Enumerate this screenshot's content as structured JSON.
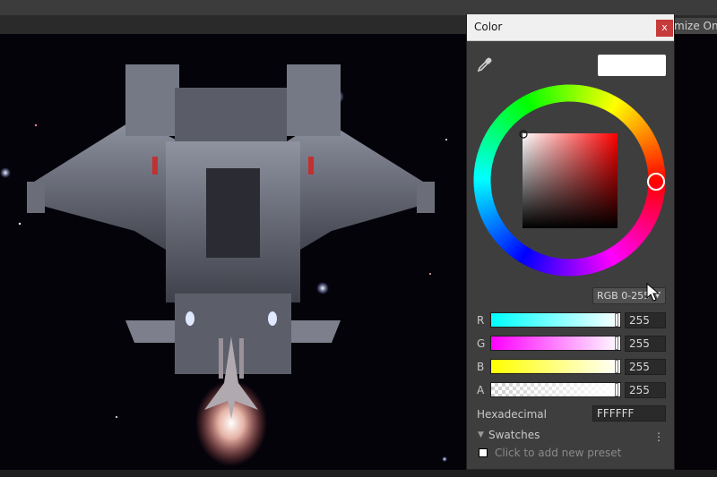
{
  "background": {
    "partial_label": "mize On"
  },
  "color_window": {
    "title": "Color",
    "close_label": "x",
    "preview_color": "#ffffff",
    "mode": "RGB 0-255",
    "channels": [
      {
        "label": "R",
        "value": "255"
      },
      {
        "label": "G",
        "value": "255"
      },
      {
        "label": "B",
        "value": "255"
      },
      {
        "label": "A",
        "value": "255"
      }
    ],
    "hex_label": "Hexadecimal",
    "hex_value": "FFFFFF",
    "swatches": {
      "label": "Swatches",
      "add_preset": "Click to add new preset"
    },
    "icons": [
      "eyedropper-icon",
      "close-icon",
      "chevron-down-icon",
      "kebab-menu-icon",
      "collapse-triangle-icon",
      "mouse-cursor-icon"
    ]
  }
}
